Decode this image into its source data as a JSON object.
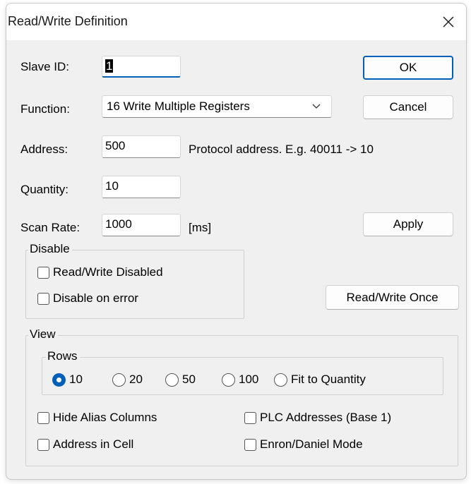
{
  "window": {
    "title": "Read/Write Definition",
    "close_symbol": "close-icon"
  },
  "form": {
    "slave_id": {
      "label": "Slave ID:",
      "value": "1"
    },
    "function": {
      "label": "Function:",
      "value": "16 Write Multiple Registers"
    },
    "address": {
      "label": "Address:",
      "value": "500",
      "hint": "Protocol address. E.g. 40011 -> 10"
    },
    "quantity": {
      "label": "Quantity:",
      "value": "10"
    },
    "scan_rate": {
      "label": "Scan Rate:",
      "value": "1000",
      "unit": "[ms]"
    }
  },
  "buttons": {
    "ok": "OK",
    "cancel": "Cancel",
    "apply": "Apply",
    "read_write_once": "Read/Write Once"
  },
  "disable": {
    "legend": "Disable",
    "read_write_disabled": {
      "label": "Read/Write Disabled",
      "checked": false
    },
    "disable_on_error": {
      "label": "Disable on error",
      "checked": false
    }
  },
  "view": {
    "legend": "View",
    "rows": {
      "legend": "Rows",
      "options": [
        "10",
        "20",
        "50",
        "100",
        "Fit to Quantity"
      ],
      "selected": "10"
    },
    "hide_alias_columns": {
      "label": "Hide Alias Columns",
      "checked": false
    },
    "plc_addresses": {
      "label": "PLC Addresses (Base 1)",
      "checked": false
    },
    "address_in_cell": {
      "label": "Address in Cell",
      "checked": false
    },
    "enron_daniel_mode": {
      "label": "Enron/Daniel Mode",
      "checked": false
    }
  },
  "colors": {
    "accent": "#005fb8",
    "dialog_bg": "#f0f0f0",
    "titlebar_bg": "#ffffff"
  }
}
